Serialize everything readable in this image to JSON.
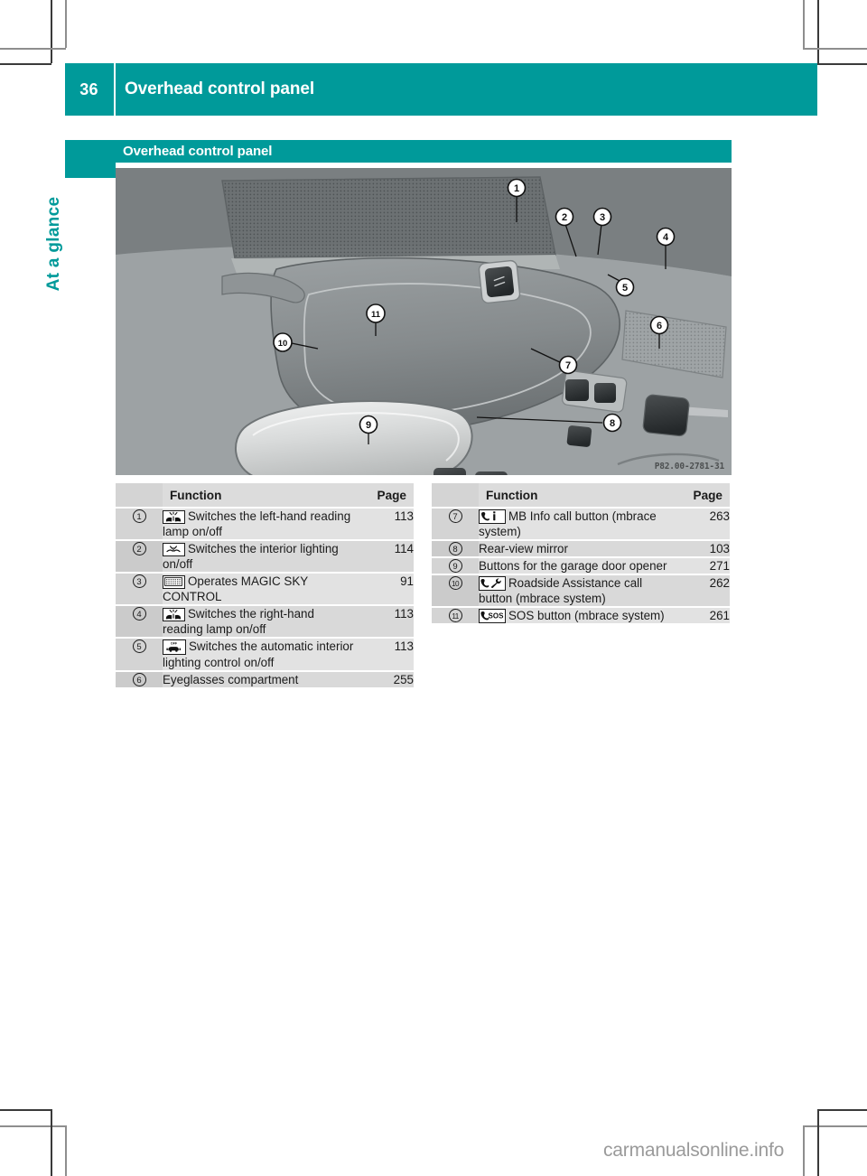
{
  "theme": {
    "teal": "#009a9a",
    "row_bg": "#e2e2e2",
    "row_bg_alt": "#d9d9d9",
    "num_bg": "#d4d4d4",
    "header_bg": "#dcdcdc"
  },
  "header": {
    "page_number": "36",
    "title": "Overhead control panel"
  },
  "sidebar": {
    "chapter_label": "At a glance"
  },
  "section": {
    "heading": "Overhead control panel"
  },
  "figure": {
    "caption_code": "P82.00-2781-31",
    "callouts": [
      "1",
      "2",
      "3",
      "4",
      "5",
      "6",
      "7",
      "8",
      "9",
      "10",
      "11"
    ]
  },
  "tables": {
    "left": {
      "columns": {
        "index": "",
        "function": "Function",
        "page": "Page"
      },
      "rows": [
        {
          "index": "1",
          "icon": "reading-lamp-left-icon",
          "text": "Switches the left-hand reading lamp on/off",
          "page": "113"
        },
        {
          "index": "2",
          "icon": "interior-lighting-icon",
          "text": "Switches the interior lighting on/off",
          "page": "114"
        },
        {
          "index": "3",
          "icon": "magic-sky-control-icon",
          "text": "Operates MAGIC SKY CONTROL",
          "page": "91"
        },
        {
          "index": "4",
          "icon": "reading-lamp-right-icon",
          "text": "Switches the right-hand reading lamp on/off",
          "page": "113"
        },
        {
          "index": "5",
          "icon": "auto-interior-lighting-icon",
          "text": "Switches the automatic interior lighting control on/off",
          "page": "113"
        },
        {
          "index": "6",
          "icon": "",
          "text": "Eyeglasses compartment",
          "page": "255"
        }
      ]
    },
    "right": {
      "columns": {
        "index": "",
        "function": "Function",
        "page": "Page"
      },
      "rows": [
        {
          "index": "7",
          "icon": "mb-info-call-icon",
          "text": "MB Info call button (mbrace system)",
          "page": "263"
        },
        {
          "index": "8",
          "icon": "",
          "text": "Rear-view mirror",
          "page": "103"
        },
        {
          "index": "9",
          "icon": "",
          "text": "Buttons for the garage door opener",
          "page": "271"
        },
        {
          "index": "10",
          "icon": "roadside-assistance-icon",
          "text": "Roadside Assistance call button (mbrace system)",
          "page": "262"
        },
        {
          "index": "11",
          "icon": "sos-call-icon",
          "text": "SOS button (mbrace system)",
          "page": "261"
        }
      ]
    }
  },
  "watermark": {
    "text": "carmanualsonline.info"
  }
}
